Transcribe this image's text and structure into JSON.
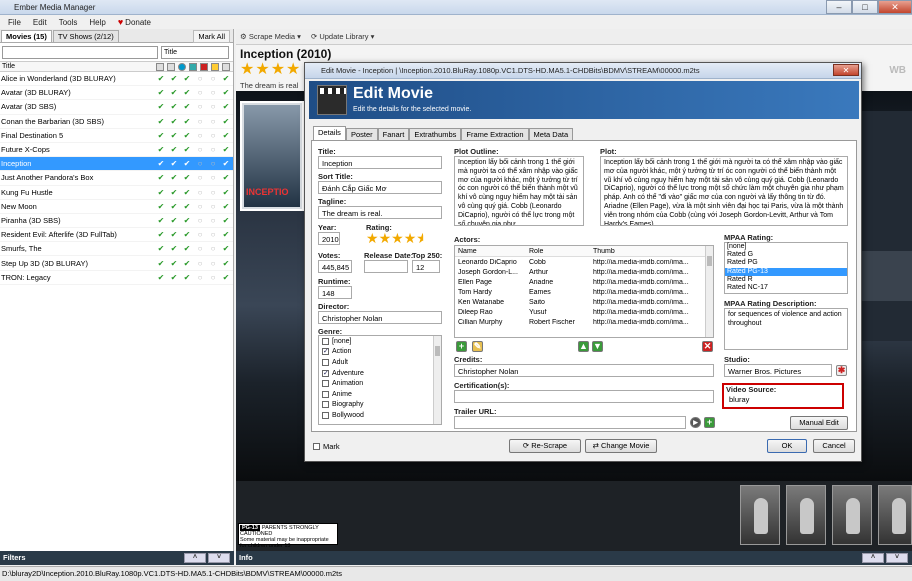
{
  "window": {
    "title": "Ember Media Manager"
  },
  "menu": {
    "file": "File",
    "edit": "Edit",
    "tools": "Tools",
    "help": "Help",
    "donate": "Donate"
  },
  "left": {
    "tab_movies": "Movies (15)",
    "tab_tv": "TV Shows (2/12)",
    "mark_all": "Mark All",
    "sort": "Title",
    "col_title": "Title",
    "movies": [
      {
        "name": "Alice in Wonderland (3D BLURAY)"
      },
      {
        "name": "Avatar (3D BLURAY)"
      },
      {
        "name": "Avatar (3D SBS)"
      },
      {
        "name": "Conan the Barbarian (3D SBS)"
      },
      {
        "name": "Final Destination 5"
      },
      {
        "name": "Future X-Cops"
      },
      {
        "name": "Inception"
      },
      {
        "name": "Just Another Pandora's Box"
      },
      {
        "name": "Kung Fu Hustle"
      },
      {
        "name": "New Moon"
      },
      {
        "name": "Piranha (3D SBS)"
      },
      {
        "name": "Resident Evil: Afterlife (3D FullTab)"
      },
      {
        "name": "Smurfs, The"
      },
      {
        "name": "Step Up 3D (3D BLURAY)"
      },
      {
        "name": "TRON: Legacy"
      }
    ],
    "filters": "Filters"
  },
  "toolbar": {
    "scrape": "Scrape Media",
    "update": "Update Library"
  },
  "main": {
    "title": "Inception (2010)",
    "tagline": "The dream is real",
    "poster_text": "INCEPTIO",
    "info": "Info",
    "mpaa_badge": "PG-13",
    "mpaa_text": "PARENTS STRONGLY CAUTIONED",
    "mpaa_sub": "Some material may be inappropriate for children under 13"
  },
  "status": {
    "path": "D:\\bluray2D\\Inception.2010.BluRay.1080p.VC1.DTS-HD.MA5.1-CHDBits\\BDMV\\STREAM\\00000.m2ts"
  },
  "dialog": {
    "title": "Edit Movie - Inception | \\Inception.2010.BluRay.1080p.VC1.DTS-HD.MA5.1-CHDBits\\BDMV\\STREAM\\00000.m2ts",
    "heading": "Edit Movie",
    "subheading": "Edit the details for the selected movie.",
    "tabs": [
      "Details",
      "Poster",
      "Fanart",
      "Extrathumbs",
      "Frame Extraction",
      "Meta Data"
    ],
    "labels": {
      "title": "Title:",
      "sort_title": "Sort Title:",
      "tagline": "Tagline:",
      "year": "Year:",
      "rating": "Rating:",
      "votes": "Votes:",
      "release": "Release Date:",
      "top250": "Top 250:",
      "runtime": "Runtime:",
      "director": "Director:",
      "genre": "Genre:",
      "outline": "Plot Outline:",
      "plot": "Plot:",
      "actors": "Actors:",
      "credits": "Credits:",
      "cert": "Certification(s):",
      "trailer": "Trailer URL:",
      "mpaa": "MPAA Rating:",
      "mpaa_desc": "MPAA Rating Description:",
      "studio": "Studio:",
      "video_source": "Video Source:"
    },
    "values": {
      "title": "Inception",
      "sort_title": "Đánh Cắp Giấc Mơ",
      "tagline": "The dream is real.",
      "year": "2010",
      "votes": "445,845",
      "release": "",
      "top250": "12",
      "runtime": "148",
      "director": "Christopher Nolan",
      "credits": "Christopher Nolan",
      "cert": "",
      "trailer": "",
      "mpaa_desc": "for sequences of violence and action throughout",
      "studio": "Warner Bros. Pictures",
      "video_source": "bluray"
    },
    "rating_value": 4.5,
    "outline": "Inception lấy bối cảnh trong 1 thế giới mà người ta có thể xâm nhập vào giấc mơ của người khác, một ý tưởng từ trí óc con người có thể biến thành một vũ khí vô cùng nguy hiểm hay một tài sản vô cùng quý giá. Cobb (Leonardo DiCaprio), người có thể lực trong một số chuyên gia như",
    "plot": "Inception lấy bối cảnh trong 1 thế giới mà người ta có thể xâm nhập vào giấc mơ của người khác, một ý tưởng từ trí óc con người có thể biến thành một vũ khí vô cùng nguy hiểm hay một tài sản vô cùng quý giá. Cobb (Leonardo DiCaprio), người có thể lực trong một số chức làm một chuyên gia như phạm pháp. Anh có thể \"đi vào\" giấc mơ của con người và lấy thông tin từ đó. Ariadne (Ellen Page), vừa là một sinh viên đại học tại Paris, vừa là một thành viên trong nhóm của Cobb (cùng với Joseph Gordon-Levitt, Arthur và Tom Hardy's Eames).",
    "genres": [
      {
        "name": "[none]",
        "checked": false
      },
      {
        "name": "Action",
        "checked": true
      },
      {
        "name": "Adult",
        "checked": false
      },
      {
        "name": "Adventure",
        "checked": true
      },
      {
        "name": "Animation",
        "checked": false
      },
      {
        "name": "Anime",
        "checked": false
      },
      {
        "name": "Biography",
        "checked": false
      },
      {
        "name": "Bollywood",
        "checked": false
      }
    ],
    "actor_cols": [
      "Name",
      "Role",
      "Thumb"
    ],
    "actors": [
      [
        "Leonardo DiCaprio",
        "Cobb",
        "http://ia.media-imdb.com/ima..."
      ],
      [
        "Joseph Gordon-L...",
        "Arthur",
        "http://ia.media-imdb.com/ima..."
      ],
      [
        "Ellen Page",
        "Ariadne",
        "http://ia.media-imdb.com/ima..."
      ],
      [
        "Tom Hardy",
        "Eames",
        "http://ia.media-imdb.com/ima..."
      ],
      [
        "Ken Watanabe",
        "Saito",
        "http://ia.media-imdb.com/ima..."
      ],
      [
        "Dileep Rao",
        "Yusuf",
        "http://ia.media-imdb.com/ima..."
      ],
      [
        "Cillian Murphy",
        "Robert Fischer",
        "http://ia.media-imdb.com/ima..."
      ]
    ],
    "mpaa_options": [
      "[none]",
      "Rated G",
      "Rated PG",
      "Rated PG-13",
      "Rated R",
      "Rated NC-17"
    ],
    "mpaa_selected": "Rated PG-13",
    "buttons": {
      "manual_edit": "Manual Edit",
      "mark": "Mark",
      "rescrape": "Re-Scrape",
      "change": "Change Movie",
      "ok": "OK",
      "cancel": "Cancel"
    }
  },
  "colors": {
    "selection": "#3399ff",
    "banner": "#2a66a8",
    "highlight_box": "#cc0000",
    "star": "#f2a900",
    "check": "#2a9a2a"
  }
}
